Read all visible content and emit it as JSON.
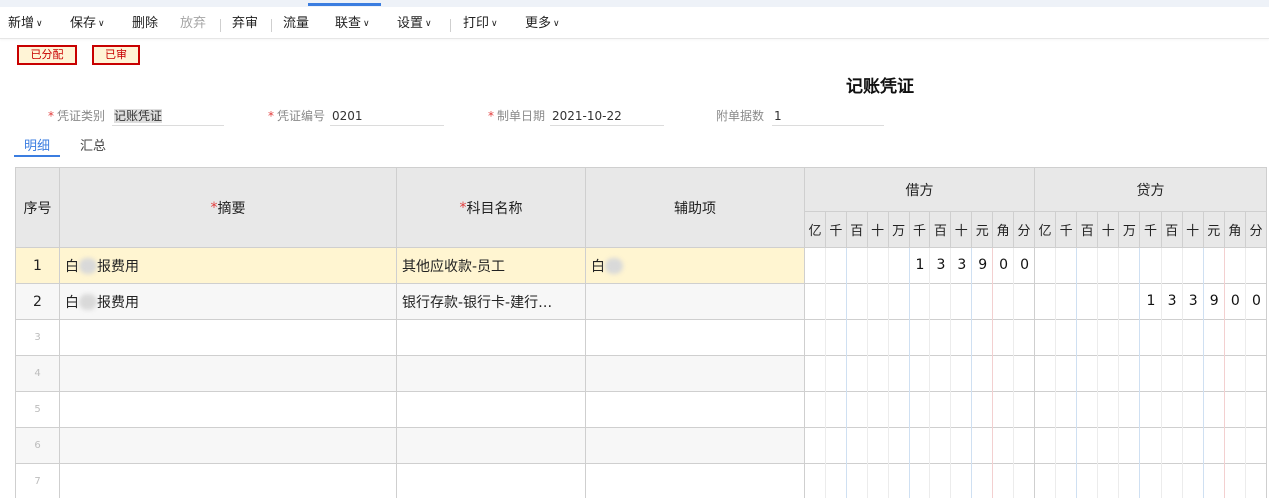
{
  "toolbar": {
    "items": [
      {
        "label": "新增",
        "dropdown": true,
        "disabled": false
      },
      {
        "label": "保存",
        "dropdown": true,
        "disabled": false
      },
      {
        "label": "删除",
        "dropdown": false,
        "disabled": false
      },
      {
        "label": "放弃",
        "dropdown": false,
        "disabled": true
      },
      {
        "label": "弃审",
        "dropdown": false,
        "disabled": false
      },
      {
        "label": "流量",
        "dropdown": false,
        "disabled": false
      },
      {
        "label": "联查",
        "dropdown": true,
        "disabled": false
      },
      {
        "label": "设置",
        "dropdown": true,
        "disabled": false
      },
      {
        "label": "打印",
        "dropdown": true,
        "disabled": false
      },
      {
        "label": "更多",
        "dropdown": true,
        "disabled": false
      }
    ],
    "dropdown_icon": "chevron-down-icon"
  },
  "status_badges": [
    "已分配",
    "已审"
  ],
  "title": "记账凭证",
  "form": {
    "voucher_type": {
      "label": "凭证类别",
      "value": "记账凭证",
      "required": true
    },
    "voucher_no": {
      "label": "凭证编号",
      "value": "0201",
      "required": true
    },
    "date": {
      "label": "制单日期",
      "value": "2021-10-22",
      "required": true
    },
    "attachments": {
      "label": "附单据数",
      "value": "1",
      "required": false
    }
  },
  "tabs": [
    {
      "label": "明细",
      "active": true
    },
    {
      "label": "汇总",
      "active": false
    }
  ],
  "table": {
    "headers": {
      "seq": "序号",
      "summary": "摘要",
      "account": "科目名称",
      "aux": "辅助项",
      "debit": "借方",
      "credit": "贷方"
    },
    "required_mark": "*",
    "units": [
      "亿",
      "千",
      "百",
      "十",
      "万",
      "千",
      "百",
      "十",
      "元",
      "角",
      "分"
    ],
    "rows": [
      {
        "seq": "1",
        "summary_prefix": "白",
        "summary_suffix": "报费用",
        "account": "其他应收款-员工",
        "aux": "白",
        "debit": "133900",
        "credit": "",
        "selected": true
      },
      {
        "seq": "2",
        "summary_prefix": "白",
        "summary_suffix": "报费用",
        "account": "银行存款-银行卡-建行…",
        "aux": "",
        "debit": "",
        "credit": "133900",
        "selected": false
      },
      {
        "seq": "3"
      },
      {
        "seq": "4"
      },
      {
        "seq": "5"
      },
      {
        "seq": "6"
      },
      {
        "seq": "7"
      }
    ]
  },
  "colors": {
    "accent": "#3b7de0",
    "required": "#e23d3d",
    "badge_border": "#c80000",
    "header_bg": "#e8e8e8",
    "selected_row_bg": "#fff5d1",
    "alt_row_bg": "#f7f7f7"
  }
}
